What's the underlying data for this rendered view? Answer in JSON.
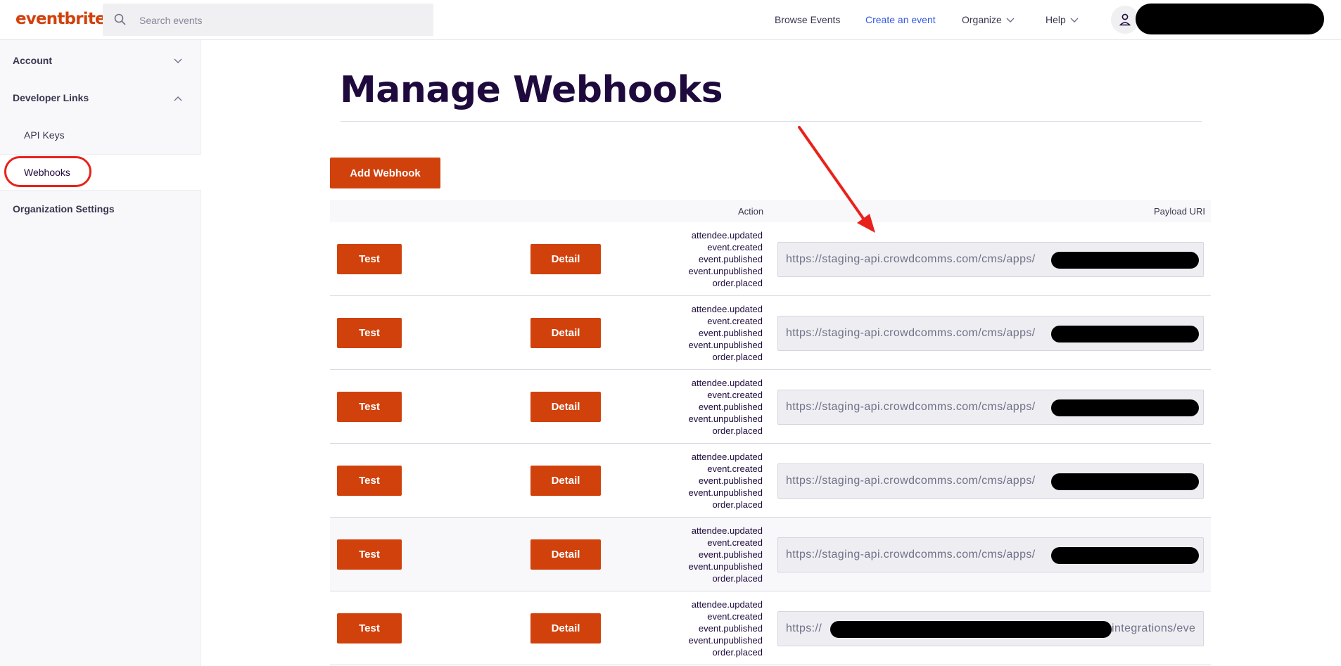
{
  "header": {
    "logo": "eventbrite",
    "search_placeholder": "Search events",
    "nav": {
      "browse": "Browse Events",
      "create": "Create an event",
      "organize": "Organize",
      "help": "Help"
    }
  },
  "sidebar": {
    "account": "Account",
    "developer_links": "Developer Links",
    "api_keys": "API Keys",
    "webhooks": "Webhooks",
    "org_settings": "Organization Settings"
  },
  "main": {
    "title": "Manage Webhooks",
    "add_button": "Add Webhook",
    "columns": {
      "action": "Action",
      "payload": "Payload URI"
    },
    "test_label": "Test",
    "detail_label": "Detail",
    "rows": [
      {
        "actions": [
          "attendee.updated",
          "event.created",
          "event.published",
          "event.unpublished",
          "order.placed"
        ],
        "uri": "https://staging-api.crowdcomms.com/cms/apps/"
      },
      {
        "actions": [
          "attendee.updated",
          "event.created",
          "event.published",
          "event.unpublished",
          "order.placed"
        ],
        "uri": "https://staging-api.crowdcomms.com/cms/apps/"
      },
      {
        "actions": [
          "attendee.updated",
          "event.created",
          "event.published",
          "event.unpublished",
          "order.placed"
        ],
        "uri": "https://staging-api.crowdcomms.com/cms/apps/"
      },
      {
        "actions": [
          "attendee.updated",
          "event.created",
          "event.published",
          "event.unpublished",
          "order.placed"
        ],
        "uri": "https://staging-api.crowdcomms.com/cms/apps/"
      },
      {
        "actions": [
          "attendee.updated",
          "event.created",
          "event.published",
          "event.unpublished",
          "order.placed"
        ],
        "uri": "https://staging-api.crowdcomms.com/cms/apps/"
      },
      {
        "actions": [
          "attendee.updated",
          "event.created",
          "event.published",
          "event.unpublished",
          "order.placed"
        ],
        "uri_prefix": "https://",
        "uri_suffix": "integrations/eve"
      }
    ]
  },
  "colors": {
    "brand": "#d1410c",
    "annotation": "#e8221b",
    "link": "#3659e3"
  }
}
